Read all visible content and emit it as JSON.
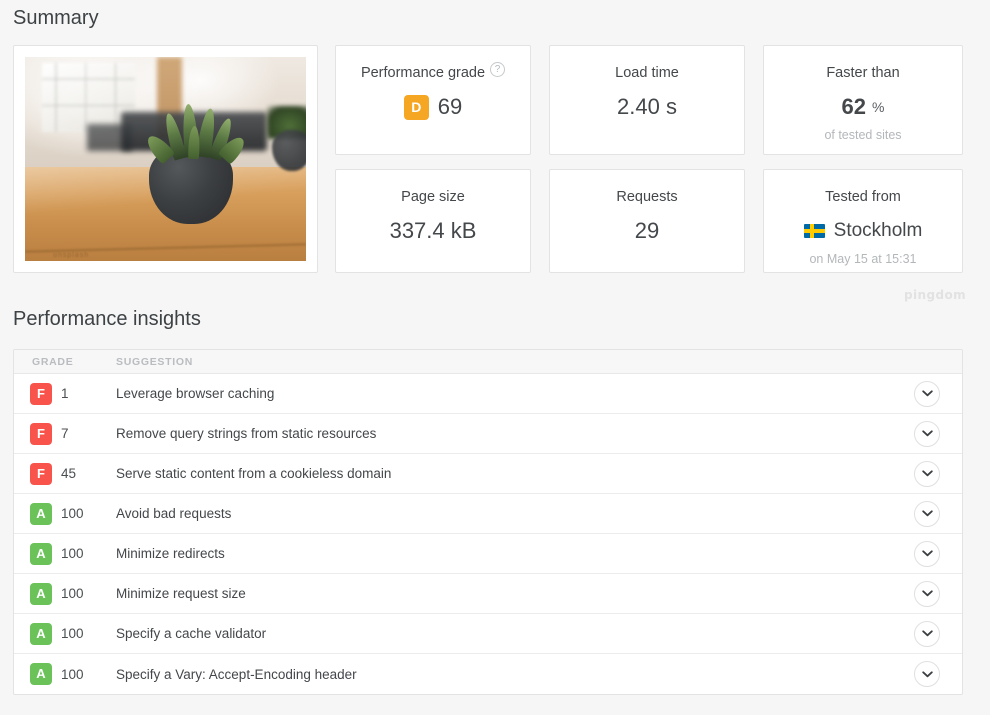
{
  "summary": {
    "title": "Summary",
    "thumbnail": {
      "alt_name": "page-screenshot-thumbnail",
      "watermark": "unsplash"
    },
    "cards": {
      "performance_grade": {
        "label": "Performance grade",
        "help_icon": "question-mark-icon",
        "help_glyph": "?",
        "badge_letter": "D",
        "badge_color": "#f5a623",
        "value": "69"
      },
      "load_time": {
        "label": "Load time",
        "value": "2.40 s"
      },
      "faster_than": {
        "label": "Faster than",
        "value": "62",
        "unit": "%",
        "sub": "of tested sites"
      },
      "page_size": {
        "label": "Page size",
        "value": "337.4 kB"
      },
      "requests": {
        "label": "Requests",
        "value": "29"
      },
      "tested_from": {
        "label": "Tested from",
        "flag_icon": "sweden-flag-icon",
        "city": "Stockholm",
        "sub": "on May 15 at 15:31"
      }
    },
    "brand_watermark": "pingdom"
  },
  "insights": {
    "title": "Performance insights",
    "columns": {
      "grade": "GRADE",
      "suggestion": "SUGGESTION"
    },
    "expand_icon": "chevron-down-icon",
    "grade_colors": {
      "A": "#6ac259",
      "F": "#f9544c"
    },
    "rows": [
      {
        "grade": "F",
        "score": "1",
        "suggestion": "Leverage browser caching"
      },
      {
        "grade": "F",
        "score": "7",
        "suggestion": "Remove query strings from static resources"
      },
      {
        "grade": "F",
        "score": "45",
        "suggestion": "Serve static content from a cookieless domain"
      },
      {
        "grade": "A",
        "score": "100",
        "suggestion": "Avoid bad requests"
      },
      {
        "grade": "A",
        "score": "100",
        "suggestion": "Minimize redirects"
      },
      {
        "grade": "A",
        "score": "100",
        "suggestion": "Minimize request size"
      },
      {
        "grade": "A",
        "score": "100",
        "suggestion": "Specify a cache validator"
      },
      {
        "grade": "A",
        "score": "100",
        "suggestion": "Specify a Vary: Accept-Encoding header"
      }
    ]
  }
}
